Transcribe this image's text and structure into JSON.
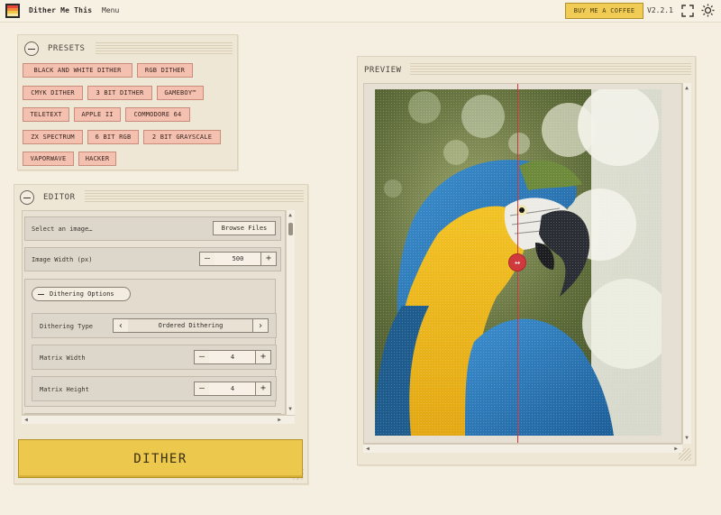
{
  "app": {
    "title": "Dither Me This",
    "menu_label": "Menu",
    "coffee_label": "BUY ME A COFFEE",
    "version": "V2.2.1",
    "icons": [
      "fullscreen-icon",
      "sun-icon"
    ],
    "accent_color": "#ecc84c"
  },
  "presets": {
    "title": "PRESETS",
    "items": [
      "BLACK AND WHITE DITHER",
      "RGB DITHER",
      "CMYK DITHER",
      "3 BIT DITHER",
      "GAMEBOY™",
      "TELETEXT",
      "APPLE II",
      "COMMODORE 64",
      "ZX SPECTRUM",
      "6 BIT RGB",
      "2 BIT GRAYSCALE",
      "VAPORWAVE",
      "HACKER"
    ]
  },
  "editor": {
    "title": "EDITOR",
    "select_image_label": "Select an image…",
    "browse_label": "Browse Files",
    "image_width_label": "Image Width (px)",
    "image_width_value": "500",
    "dithering_group_label": "Dithering Options",
    "dithering_type_label": "Dithering Type",
    "dithering_type_value": "Ordered Dithering",
    "matrix_width_label": "Matrix Width",
    "matrix_width_value": "4",
    "matrix_height_label": "Matrix Height",
    "matrix_height_value": "4",
    "minus": "—",
    "plus": "+",
    "prev": "‹",
    "next": "›"
  },
  "dither_button_label": "DITHER",
  "preview": {
    "title": "PREVIEW",
    "comparison_split_fraction": 0.5
  }
}
